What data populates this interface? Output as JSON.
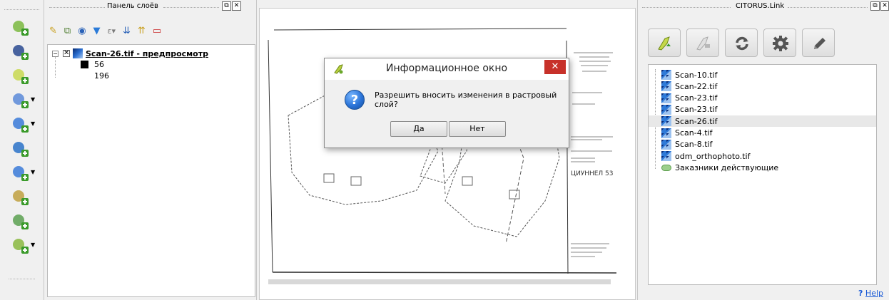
{
  "left_toolbar": {
    "tools": [
      {
        "icon": "add-vector-layer-icon",
        "dropdown": false
      },
      {
        "icon": "add-raster-layer-icon",
        "dropdown": false
      },
      {
        "icon": "add-postgis-layer-icon",
        "dropdown": false
      },
      {
        "icon": "add-database-layer-icon",
        "dropdown": true
      },
      {
        "icon": "add-wms-layer-icon",
        "dropdown": true
      },
      {
        "icon": "add-wcs-layer-icon",
        "dropdown": false
      },
      {
        "icon": "add-wfs-layer-icon",
        "dropdown": true
      },
      {
        "icon": "add-delimited-text-icon",
        "dropdown": false
      },
      {
        "icon": "add-virtual-layer-icon",
        "dropdown": false
      },
      {
        "icon": "new-shapefile-icon",
        "dropdown": true
      }
    ]
  },
  "layers_panel": {
    "title": "Панель слоёв",
    "toolbar_icons": [
      "style-icon",
      "add-group-icon",
      "visibility-icon",
      "filter-icon",
      "filter-expression-icon",
      "expand-all-icon",
      "collapse-all-icon",
      "remove-layer-icon"
    ],
    "layer": {
      "name": "Scan-26.tif - предпросмотр",
      "checked": true,
      "legend": [
        {
          "label": "56",
          "color": "#000000"
        },
        {
          "label": "196",
          "color": "#ffffff"
        }
      ]
    }
  },
  "dialog": {
    "title": "Информационное окно",
    "message": "Разрешить вносить изменения в растровый слой?",
    "yes_label": "Да",
    "no_label": "Нет",
    "close_glyph": "✕",
    "icon": "question-icon"
  },
  "citorus": {
    "title": "CITORUS.Link",
    "toolbar_icons": [
      "enable-edit-icon",
      "disable-edit-icon",
      "refresh-icon",
      "settings-icon",
      "pencil-icon"
    ],
    "layers": [
      {
        "name": "Scan-10.tif",
        "type": "raster"
      },
      {
        "name": "Scan-22.tif",
        "type": "raster"
      },
      {
        "name": "Scan-23.tif",
        "type": "raster"
      },
      {
        "name": "Scan-23.tif",
        "type": "raster"
      },
      {
        "name": "Scan-26.tif",
        "type": "raster",
        "selected": true
      },
      {
        "name": "Scan-4.tif",
        "type": "raster"
      },
      {
        "name": "Scan-8.tif",
        "type": "raster"
      },
      {
        "name": "odm_orthophoto.tif",
        "type": "raster"
      },
      {
        "name": "Заказники действующие",
        "type": "polygon"
      }
    ],
    "help_mark": "?",
    "help_label": "Help"
  },
  "map": {
    "map_label": "ЦИУННЕЛ 53"
  }
}
